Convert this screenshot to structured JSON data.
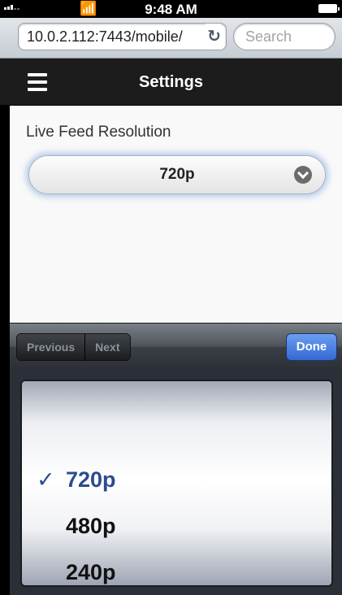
{
  "status_bar": {
    "time": "9:48 AM",
    "wifi_icon": "wifi-icon",
    "battery_icon": "battery-icon"
  },
  "browser": {
    "url": "10.0.2.112:7443/mobile/",
    "search_placeholder": "Search",
    "reload_icon": "↻"
  },
  "header": {
    "title": "Settings",
    "menu_icon": "hamburger-menu-icon"
  },
  "settings": {
    "live_feed_label": "Live Feed Resolution",
    "selected_resolution": "720p"
  },
  "keyboard_toolbar": {
    "previous_label": "Previous",
    "next_label": "Next",
    "done_label": "Done"
  },
  "picker": {
    "check_mark": "✓",
    "options": [
      "720p",
      "480p",
      "240p"
    ],
    "selected_index": 0
  },
  "colors": {
    "header_bg": "#1c1c1c",
    "done_button": "#3468d4",
    "selected_option": "#2c4c8c"
  }
}
